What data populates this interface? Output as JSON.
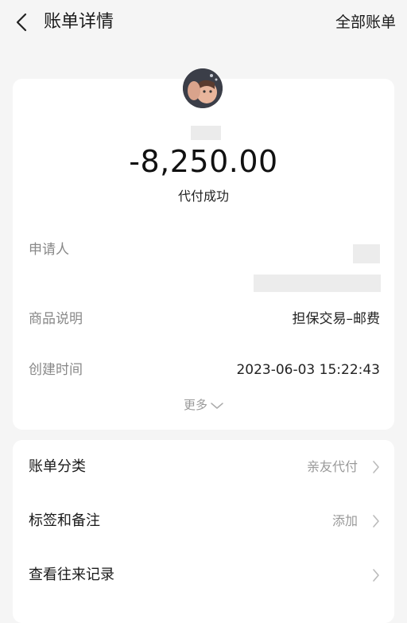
{
  "header": {
    "title": "账单详情",
    "right_action": "全部账单",
    "back_icon": "chevron-left-icon"
  },
  "summary": {
    "amount": "-8,250.00",
    "status": "代付成功"
  },
  "details": {
    "applicant_label": "申请人",
    "product_label": "商品说明",
    "product_value": "担保交易–邮费",
    "created_label": "创建时间",
    "created_value": "2023-06-03 15:22:43",
    "more_label": "更多"
  },
  "actions": [
    {
      "label": "账单分类",
      "value": "亲友代付"
    },
    {
      "label": "标签和备注",
      "value": "添加"
    },
    {
      "label": "查看往来记录",
      "value": ""
    }
  ],
  "colors": {
    "background": "#f5f5f5",
    "card": "#ffffff",
    "secondary_text": "#888888",
    "muted_text": "#999999"
  }
}
